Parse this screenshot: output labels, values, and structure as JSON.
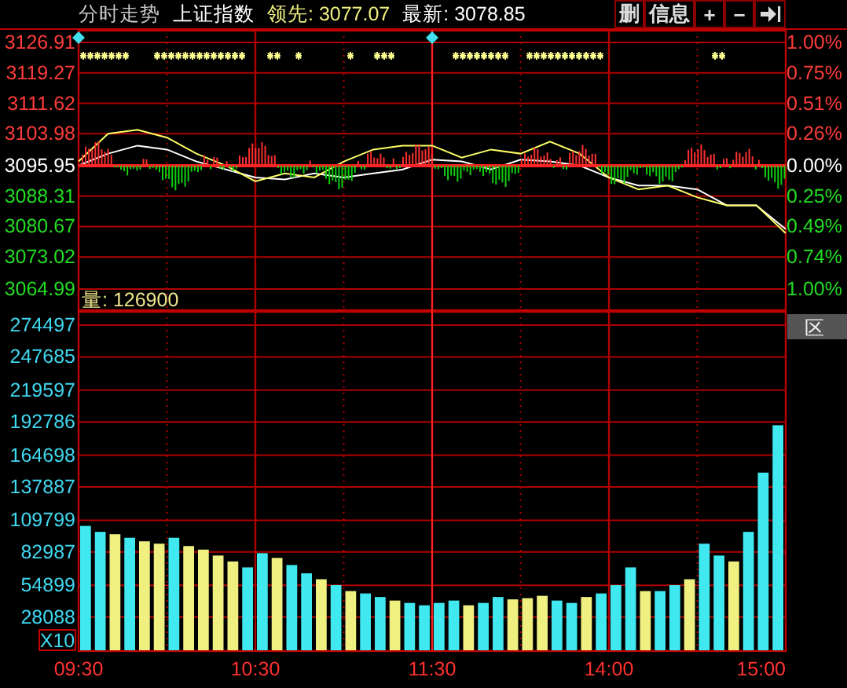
{
  "header": {
    "title": "分时走势",
    "index_name": "上证指数",
    "lead": "领先: 3077.07",
    "latest": "最新: 3078.85",
    "buttons": [
      {
        "kind": "text",
        "label": "删"
      },
      {
        "kind": "text",
        "label": "信息"
      },
      {
        "kind": "text",
        "label": "+"
      },
      {
        "kind": "text",
        "label": "−"
      },
      {
        "kind": "end"
      }
    ]
  },
  "price_panel": {
    "left_labels": [
      {
        "text": "3126.91",
        "kind": "up"
      },
      {
        "text": "3119.27",
        "kind": "up"
      },
      {
        "text": "3111.62",
        "kind": "up"
      },
      {
        "text": "3103.98",
        "kind": "up"
      },
      {
        "text": "3095.95",
        "kind": "flat"
      },
      {
        "text": "3088.31",
        "kind": "down"
      },
      {
        "text": "3080.67",
        "kind": "down"
      },
      {
        "text": "3073.02",
        "kind": "down"
      },
      {
        "text": "3064.99",
        "kind": "down"
      }
    ],
    "right_labels": [
      {
        "text": "1.00%",
        "kind": "up"
      },
      {
        "text": "0.75%",
        "kind": "up"
      },
      {
        "text": "0.51%",
        "kind": "up"
      },
      {
        "text": "0.26%",
        "kind": "up"
      },
      {
        "text": "0.00%",
        "kind": "flat"
      },
      {
        "text": "0.25%",
        "kind": "down"
      },
      {
        "text": "0.49%",
        "kind": "down"
      },
      {
        "text": "0.74%",
        "kind": "down"
      },
      {
        "text": "1.00%",
        "kind": "down"
      }
    ],
    "chart_data": {
      "type": "line",
      "grid": true,
      "ylim": [
        3064.99,
        3126.91
      ],
      "yticks": [
        3126.91,
        3119.27,
        3111.62,
        3103.98,
        3095.95,
        3088.31,
        3080.67,
        3073.02,
        3064.99
      ],
      "series": [
        {
          "color": "#ffffff",
          "values": [
            3096,
            3099,
            3101,
            3100,
            3097,
            3095,
            3093,
            3092.5,
            3094,
            3093,
            3094,
            3095,
            3097.5,
            3097,
            3095,
            3097.5,
            3097,
            3096,
            3093,
            3091,
            3091,
            3090,
            3086,
            3086,
            3080
          ]
        },
        {
          "color": "#ffff66",
          "values": [
            3097,
            3104,
            3105,
            3103,
            3099,
            3096,
            3092,
            3094,
            3093,
            3097,
            3100,
            3101,
            3101,
            3098,
            3100,
            3099,
            3102,
            3099,
            3093,
            3090,
            3091,
            3088,
            3086,
            3086,
            3079
          ]
        }
      ]
    }
  },
  "volume_panel": {
    "caption": "量: 126900",
    "range_button": "区",
    "scale": "X10",
    "left_labels": [
      "274497",
      "247685",
      "219597",
      "192786",
      "164698",
      "137887",
      "109799",
      "82987",
      "54899",
      "28088"
    ],
    "time_labels": [
      "09:30",
      "10:30",
      "11:30",
      "14:00",
      "15:00"
    ],
    "chart_data": {
      "type": "bar",
      "grid": true,
      "ylim": [
        0,
        274497
      ],
      "yticks": [
        274497,
        247685,
        219597,
        192786,
        164698,
        137887,
        109799,
        82987,
        54899,
        28088
      ],
      "series": [
        {
          "color": "#40e8f0",
          "values": [
            105000,
            100000,
            null,
            95000,
            null,
            null,
            95000,
            null,
            null,
            null,
            null,
            70000,
            82000,
            null,
            72000,
            65000,
            null,
            55000,
            null,
            48000,
            45000,
            null,
            40000,
            38000,
            40000,
            42000,
            null,
            40000,
            45000,
            null,
            null,
            null,
            42000,
            40000,
            null,
            48000,
            55000,
            70000,
            null,
            50000,
            55000,
            null,
            90000,
            80000,
            null,
            100000,
            150000,
            190000
          ]
        },
        {
          "color": "#f0f080",
          "values": [
            null,
            null,
            98000,
            null,
            92000,
            90000,
            null,
            88000,
            85000,
            80000,
            75000,
            null,
            null,
            78000,
            null,
            null,
            60000,
            null,
            50000,
            null,
            null,
            42000,
            null,
            null,
            null,
            null,
            38000,
            null,
            null,
            43000,
            44000,
            46000,
            null,
            null,
            45000,
            null,
            null,
            null,
            50000,
            null,
            null,
            60000,
            null,
            null,
            75000,
            null,
            null,
            null
          ]
        }
      ]
    }
  }
}
